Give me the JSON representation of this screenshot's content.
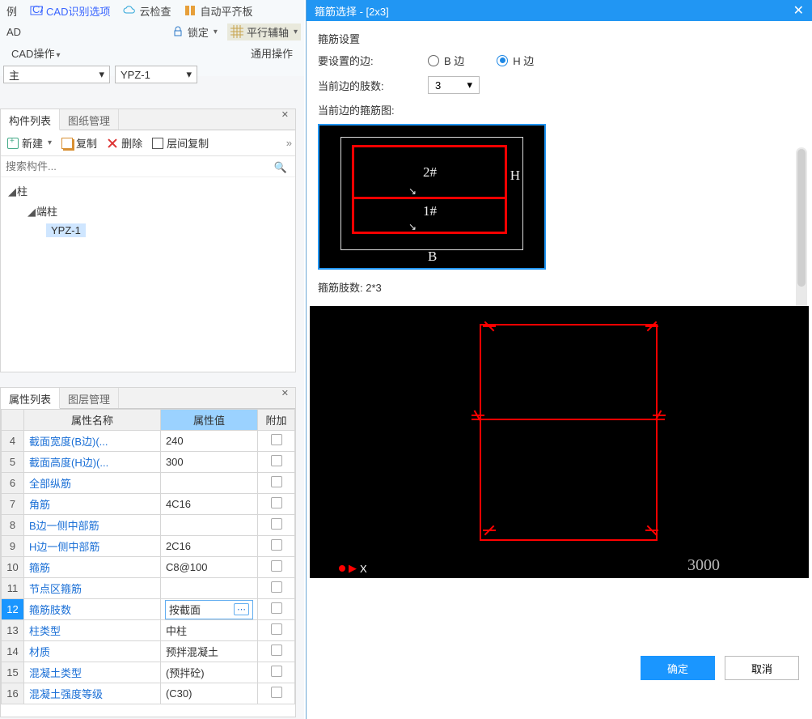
{
  "ribbon": {
    "btn_example": "例",
    "btn_cad_opts": "CAD识别选项",
    "btn_cloud": "云检查",
    "btn_flat": "自动平齐板",
    "row2_ad": "AD",
    "btn_lock": "锁定",
    "btn_parallel": "平行辅轴",
    "row3_cad_ops": "CAD操作",
    "label_common": "通用操作",
    "combo1": "主",
    "combo2": "YPZ-1"
  },
  "components_panel": {
    "tab_list": "构件列表",
    "tab_draw": "图纸管理",
    "btn_new": "新建",
    "btn_copy": "复制",
    "btn_delete": "删除",
    "btn_inter": "层间复制",
    "search_placeholder": "搜索构件...",
    "tree_root": "柱",
    "tree_sub": "端柱",
    "tree_leaf": "YPZ-1"
  },
  "props_panel": {
    "tab_props": "属性列表",
    "tab_layer": "图层管理",
    "col_name": "属性名称",
    "col_value": "属性值",
    "col_extra": "附加",
    "rows": [
      {
        "n": "4",
        "name": "截面宽度(B边)(...",
        "val": "240"
      },
      {
        "n": "5",
        "name": "截面高度(H边)(...",
        "val": "300"
      },
      {
        "n": "6",
        "name": "全部纵筋",
        "val": ""
      },
      {
        "n": "7",
        "name": "角筋",
        "val": "4C16"
      },
      {
        "n": "8",
        "name": "B边一侧中部筋",
        "val": ""
      },
      {
        "n": "9",
        "name": "H边一侧中部筋",
        "val": "2C16"
      },
      {
        "n": "10",
        "name": "箍筋",
        "val": "C8@100"
      },
      {
        "n": "11",
        "name": "节点区箍筋",
        "val": ""
      },
      {
        "n": "12",
        "name": "箍筋肢数",
        "val": "按截面",
        "sel": true
      },
      {
        "n": "13",
        "name": "柱类型",
        "val": "中柱"
      },
      {
        "n": "14",
        "name": "材质",
        "val": "预拌混凝土"
      },
      {
        "n": "15",
        "name": "混凝土类型",
        "val": "(预拌砼)"
      },
      {
        "n": "16",
        "name": "混凝土强度等级",
        "val": "(C30)"
      }
    ]
  },
  "dialog": {
    "title": "箍筋选择 - [2x3]",
    "section": "箍筋设置",
    "label_side": "要设置的边:",
    "radio_b": "B 边",
    "radio_h": "H 边",
    "label_limbs": "当前边的肢数:",
    "limbs_value": "3",
    "label_diagram": "当前边的箍筋图:",
    "diag_t2": "2#",
    "diag_t1": "1#",
    "diag_H": "H",
    "diag_B": "B",
    "summary": "箍筋肢数: 2*3",
    "axis_x": "X",
    "big_num": "3000",
    "btn_ok": "确定",
    "btn_cancel": "取消"
  }
}
